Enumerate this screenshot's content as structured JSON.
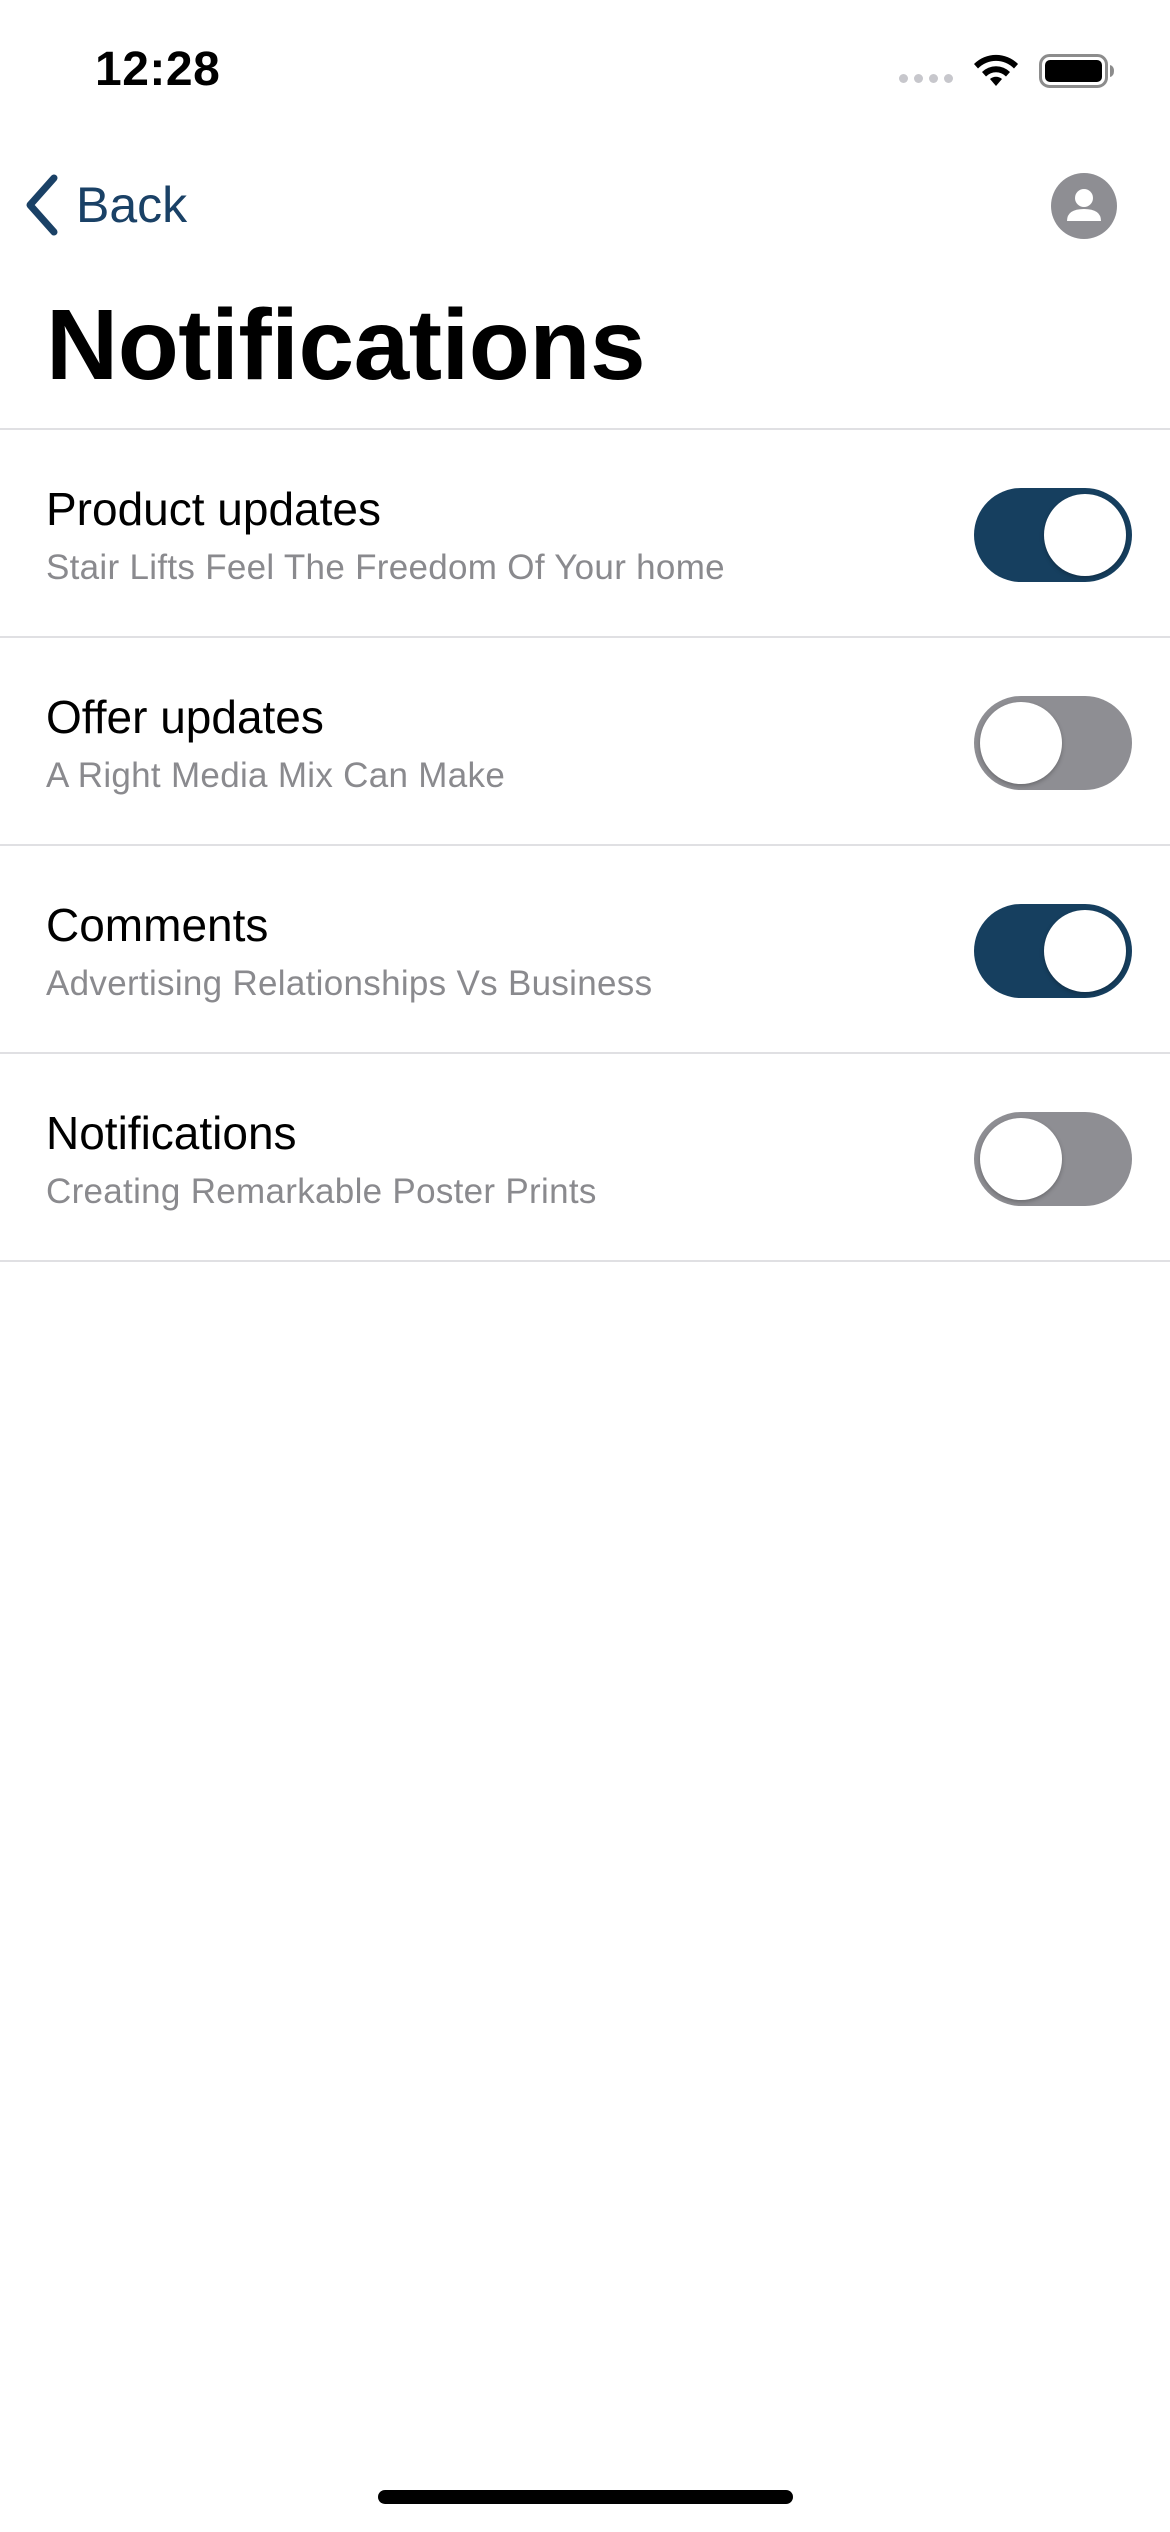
{
  "status_bar": {
    "time": "12:28",
    "icons": [
      "cellular-signal-icon",
      "wifi-icon",
      "battery-icon"
    ]
  },
  "nav": {
    "back_label": "Back",
    "back_icon": "chevron-left-icon",
    "profile_icon": "person-icon"
  },
  "page": {
    "title": "Notifications"
  },
  "settings": [
    {
      "title": "Product updates",
      "subtitle": "Stair Lifts Feel The Freedom Of Your home",
      "enabled": true
    },
    {
      "title": "Offer updates",
      "subtitle": "A Right Media Mix Can Make",
      "enabled": false
    },
    {
      "title": "Comments",
      "subtitle": "Advertising Relationships Vs Business",
      "enabled": true
    },
    {
      "title": "Notifications",
      "subtitle": "Creating Remarkable Poster Prints",
      "enabled": false
    }
  ],
  "colors": {
    "accent": "#163f5f",
    "back_text": "#1a4166",
    "toggle_off": "#8e8e93",
    "subtitle_text": "#8a8a8e",
    "separator": "#e0e0e3"
  }
}
